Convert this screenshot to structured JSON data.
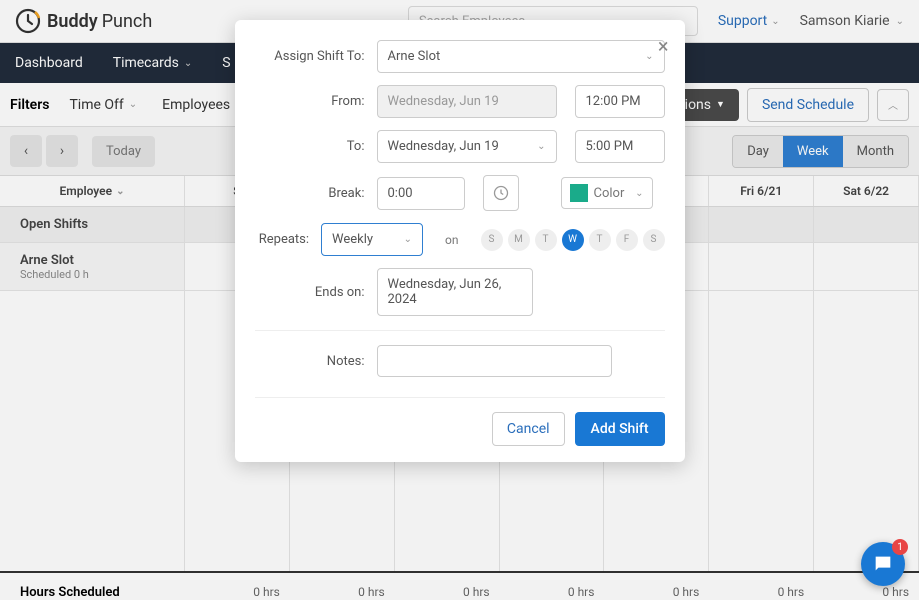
{
  "header": {
    "brand1": "Buddy",
    "brand2": "Punch",
    "search_placeholder": "Search Employees",
    "support": "Support",
    "user": "Samson Kiarie"
  },
  "nav": {
    "dashboard": "Dashboard",
    "timecards": "Timecards",
    "schedule_partial": "S"
  },
  "filters": {
    "label": "Filters",
    "timeoff": "Time Off",
    "employees": "Employees",
    "options": "Options",
    "send": "Send Schedule"
  },
  "toolbar": {
    "today": "Today",
    "day": "Day",
    "week": "Week",
    "month": "Month"
  },
  "schedule": {
    "employee_header": "Employee",
    "days": [
      "S",
      "",
      "",
      "",
      "",
      "Fri 6/21",
      "Sat 6/22"
    ],
    "open_shifts": "Open Shifts",
    "emp_name": "Arne Slot",
    "emp_sched": "Scheduled   0 h",
    "hours_label": "Hours Scheduled",
    "hours": [
      "0 hrs",
      "0 hrs",
      "0 hrs",
      "0 hrs",
      "0 hrs",
      "0 hrs",
      "0 hrs"
    ]
  },
  "modal": {
    "assign_label": "Assign Shift To:",
    "assign_value": "Arne Slot",
    "from_label": "From:",
    "from_date": "Wednesday, Jun 19",
    "from_time": "12:00 PM",
    "to_label": "To:",
    "to_date": "Wednesday, Jun 19",
    "to_time": "5:00 PM",
    "break_label": "Break:",
    "break_value": "0:00",
    "color_label": "Color",
    "repeats_label": "Repeats:",
    "repeats_value": "Weekly",
    "on_label": "on",
    "days": [
      "S",
      "M",
      "T",
      "W",
      "T",
      "F",
      "S"
    ],
    "day_active_index": 3,
    "ends_label": "Ends on:",
    "ends_value": "Wednesday, Jun 26, 2024",
    "notes_label": "Notes:",
    "cancel": "Cancel",
    "add": "Add Shift"
  },
  "chat": {
    "badge": "1"
  }
}
